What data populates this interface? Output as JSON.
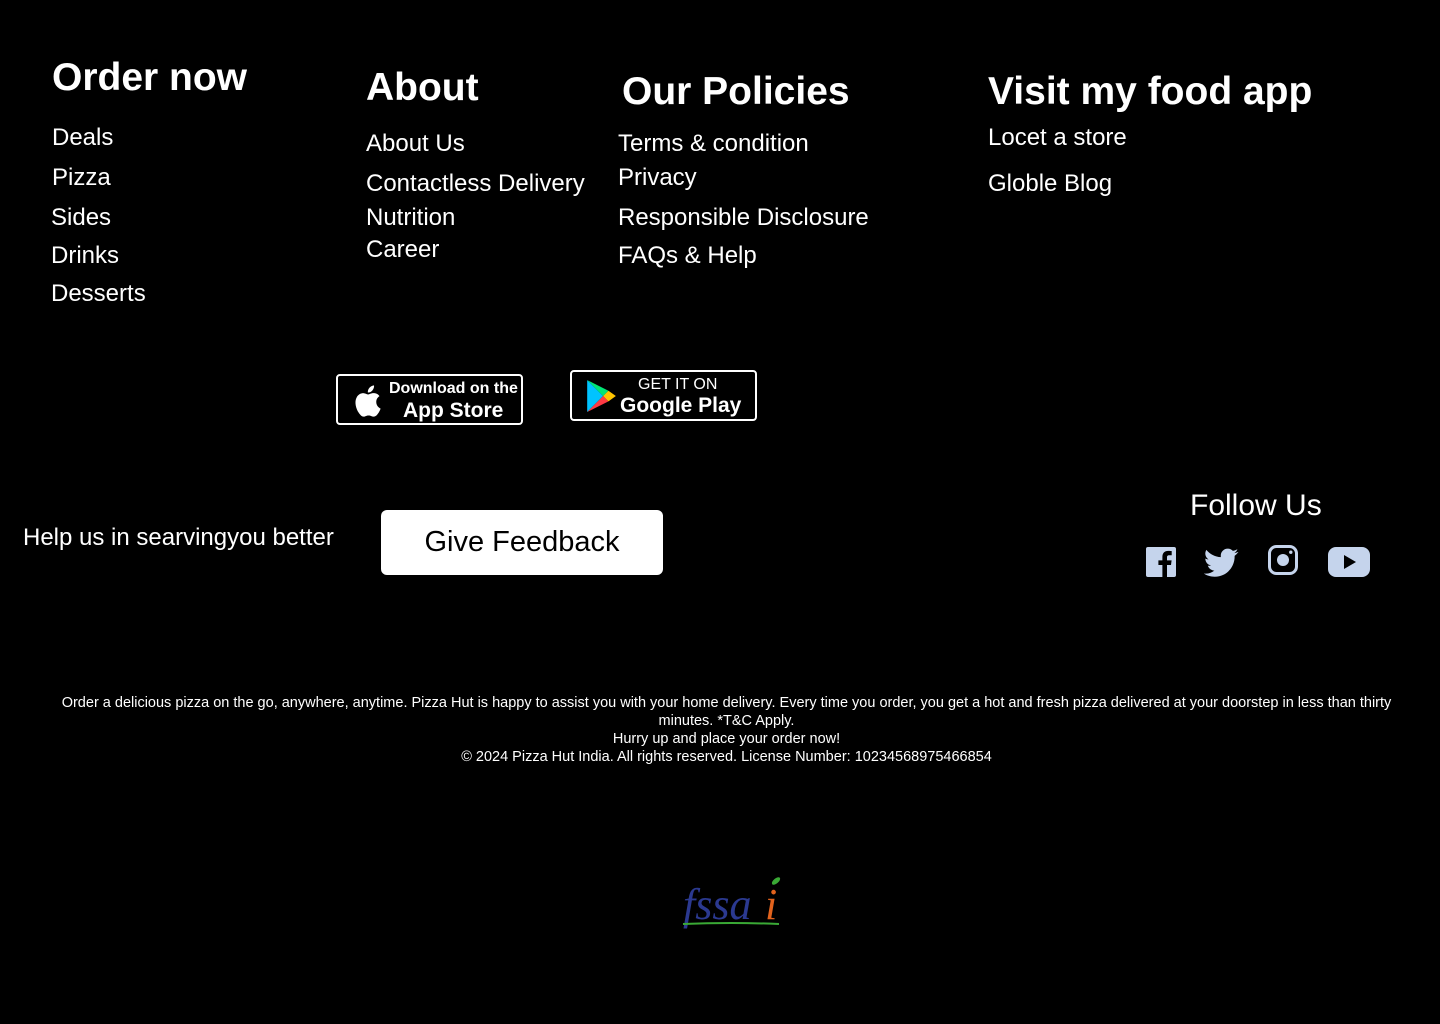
{
  "order": {
    "title": "Order now",
    "items": [
      "Deals",
      "Pizza",
      "Sides",
      "Drinks",
      "Desserts"
    ]
  },
  "about": {
    "title": "About",
    "items": [
      "About Us",
      "Contactless Delivery",
      "Nutrition",
      "Career"
    ]
  },
  "policies": {
    "title": "Our Policies",
    "items": [
      "Terms & condition",
      "Privacy",
      "Responsible Disclosure",
      "FAQs & Help"
    ]
  },
  "app": {
    "title": "Visit my food app",
    "items": [
      "Locet a store",
      "Globle Blog"
    ]
  },
  "stores": {
    "apple": {
      "line1": "Download on the",
      "line2": "App Store"
    },
    "google": {
      "line1": "GET IT ON",
      "line2": "Google Play"
    }
  },
  "feedback": {
    "prompt": "Help us in searvingyou better",
    "button": "Give Feedback"
  },
  "social": {
    "title": "Follow Us",
    "icons": [
      "facebook-icon",
      "twitter-icon",
      "instagram-icon",
      "youtube-icon"
    ],
    "icon_color": "#c5d4ec"
  },
  "legal": {
    "line1": "Order a delicious pizza on the go, anywhere, anytime. Pizza Hut is happy to assist you with your home delivery. Every time you order, you get a hot and fresh pizza delivered at your doorstep in less than thirty minutes. *T&C Apply.",
    "line2": "Hurry up and place your order now!",
    "line3": "© 2024 Pizza Hut India. All rights reserved. License Number: 10234568975466854"
  },
  "logo": {
    "text": "fssai",
    "colors": {
      "primary": "#2b3990",
      "accent": "#e2631d",
      "leaf": "#3aa935"
    }
  }
}
